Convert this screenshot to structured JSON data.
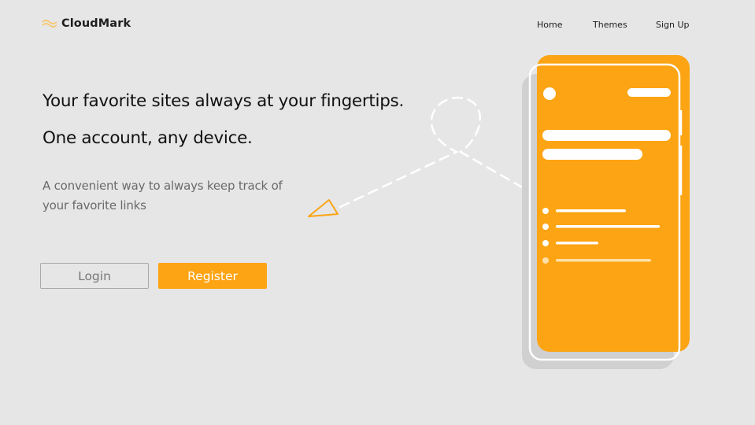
{
  "brand": {
    "name": "CloudMark",
    "icon": "wave-logo-icon",
    "accent_color": "#fca413"
  },
  "nav": {
    "items": [
      {
        "label": "Home"
      },
      {
        "label": "Themes"
      },
      {
        "label": "Sign Up"
      }
    ]
  },
  "hero": {
    "headline_1": "Your favorite sites always at your fingertips.",
    "headline_2": "One account, any device.",
    "subtext": "A convenient way to always keep track of your favorite links"
  },
  "buttons": {
    "login": "Login",
    "register": "Register"
  },
  "colors": {
    "background": "#e6e6e6",
    "accent": "#fca413",
    "phone_shadow": "#d0d0d0"
  }
}
